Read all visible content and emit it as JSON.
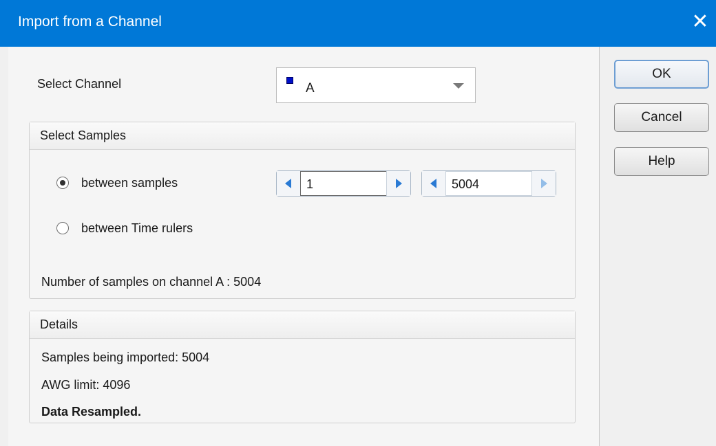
{
  "dialog": {
    "title": "Import from a Channel",
    "close_glyph": "✕"
  },
  "channel": {
    "label": "Select Channel",
    "selected": "A",
    "swatch_color": "#0010c8"
  },
  "select_samples": {
    "title": "Select Samples",
    "option_between_samples": "between samples",
    "option_between_rulers": "between Time rulers",
    "selected_option": "between samples",
    "start_value": "1",
    "end_value": "5004",
    "count_text": "Number of samples on channel A : 5004"
  },
  "details": {
    "title": "Details",
    "line1": "Samples being imported: 5004",
    "line2": "AWG limit: 4096",
    "line3": "Data Resampled."
  },
  "buttons": {
    "ok": "OK",
    "cancel": "Cancel",
    "help": "Help"
  }
}
